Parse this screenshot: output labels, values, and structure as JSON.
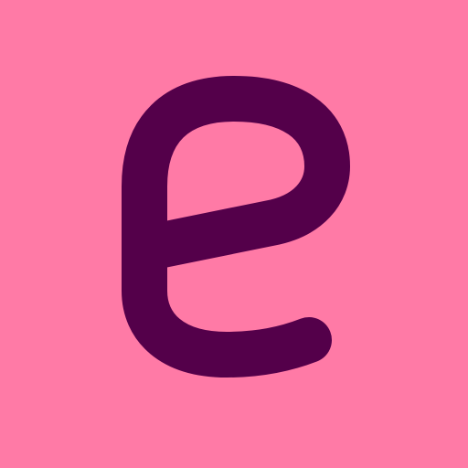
{
  "app_icon": {
    "logo_letter": "e",
    "icon_name": "letter-e-logo-icon",
    "colors": {
      "background": "#ff7aa6",
      "glyph": "#54004a"
    }
  }
}
